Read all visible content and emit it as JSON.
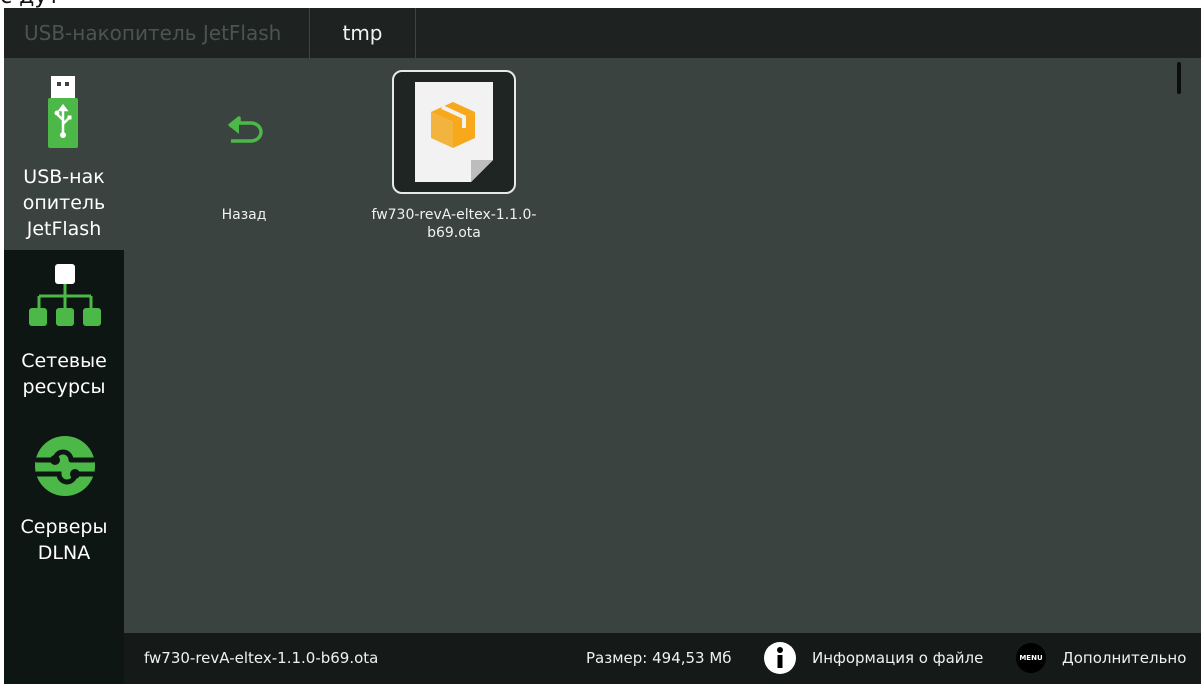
{
  "top_crop_text": "с дут",
  "breadcrumb": {
    "items": [
      {
        "label": "USB-накопитель JetFlash"
      },
      {
        "label": "tmp"
      }
    ]
  },
  "sidebar": {
    "items": [
      {
        "label": "USB-нак опитель JetFlash",
        "label_lines": [
          "USB-нак",
          "опитель",
          "JetFlash"
        ],
        "icon": "usb-drive-icon",
        "active": true
      },
      {
        "label": "Сетевые ресурсы",
        "label_lines": [
          "Сетевые",
          "ресурсы"
        ],
        "icon": "network-tree-icon",
        "active": false
      },
      {
        "label": "Серверы DLNA",
        "label_lines": [
          "Серверы",
          "DLNA"
        ],
        "icon": "dlna-icon",
        "active": false
      }
    ]
  },
  "content": {
    "tiles": [
      {
        "name": "Назад",
        "icon": "back-arrow-icon"
      },
      {
        "name": "fw730-revA-eltex-1.1.0-b69.ota",
        "label_lines": [
          "fw730-revA-eltex-1.1.0-",
          "b69.ota"
        ],
        "icon": "package-file-icon",
        "selected": true
      }
    ]
  },
  "status_bar": {
    "filename": "fw730-revA-eltex-1.1.0-b69.ota",
    "size": "Размер: 494,53 Мб",
    "info_label": "Информация о файле",
    "menu_badge": "MENU",
    "more_label": "Дополнительно"
  },
  "colors": {
    "accent_green": "#4cb848",
    "package_orange": "#f7a81b",
    "background": "#3a4340",
    "sidebar": "#0e1614"
  }
}
